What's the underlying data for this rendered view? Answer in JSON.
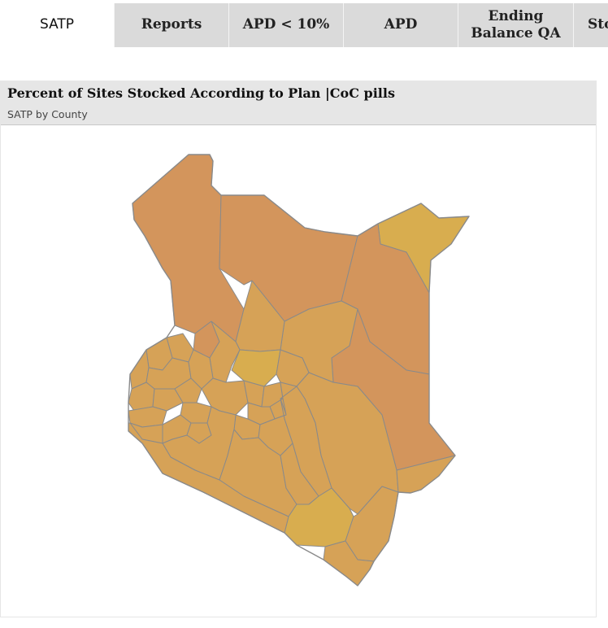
{
  "tabs": [
    {
      "label": "SATP",
      "active": true
    },
    {
      "label": "Reports",
      "active": false
    },
    {
      "label": "APD < 10%",
      "active": false
    },
    {
      "label": "APD",
      "active": false
    },
    {
      "label": "Ending Balance QA",
      "active": false
    },
    {
      "label": "Sto",
      "active": false
    }
  ],
  "panel": {
    "title": "Percent of Sites Stocked According to Plan |CoC pills",
    "subtitle": "SATP by County"
  },
  "map": {
    "fill_colors": {
      "low": "#d3955c",
      "mid": "#d6a257",
      "high": "#d8ad4f",
      "border": "#8a8a8a"
    }
  }
}
